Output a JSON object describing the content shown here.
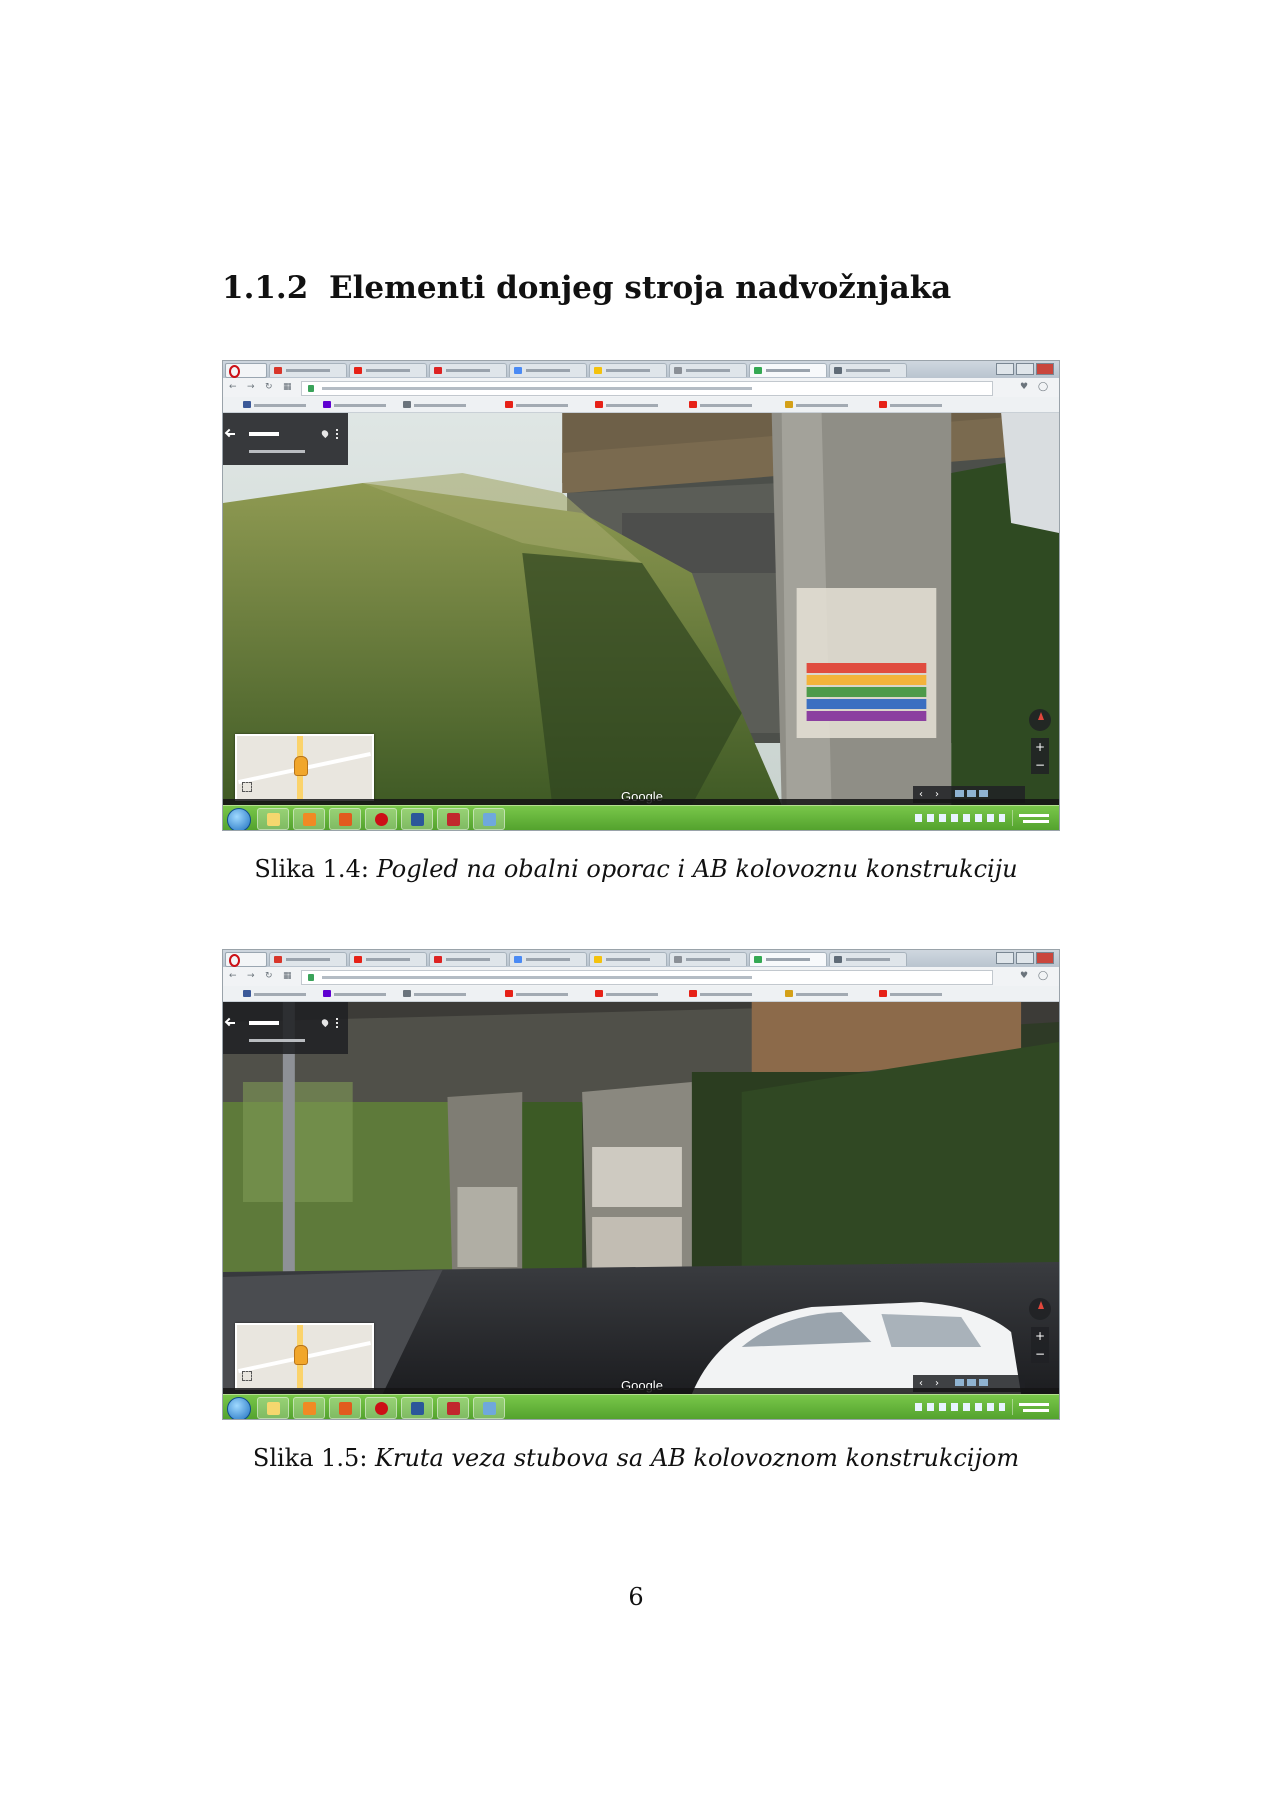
{
  "section": {
    "number": "1.1.2",
    "title": "Elementi donjeg stroja nadvožnjaka"
  },
  "figures": [
    {
      "label": "Slika 1.4:",
      "caption": "Pogled na obalni oporac i AB kolovoznu konstrukciju",
      "image": "Street View screenshot of a concrete overpass pier with graffiti and a grassy embankment"
    },
    {
      "label": "Slika 1.5:",
      "caption": "Kruta veza stubova sa AB kolovoznom konstrukcijom",
      "image": "Street View screenshot of overpass piers rigidly connected to the deck, road and white car in foreground"
    }
  ],
  "page_number": "6",
  "colors": {
    "taskbar": "#5fb236",
    "opera_red": "#cc0f16",
    "sv_panel": "#202124"
  }
}
